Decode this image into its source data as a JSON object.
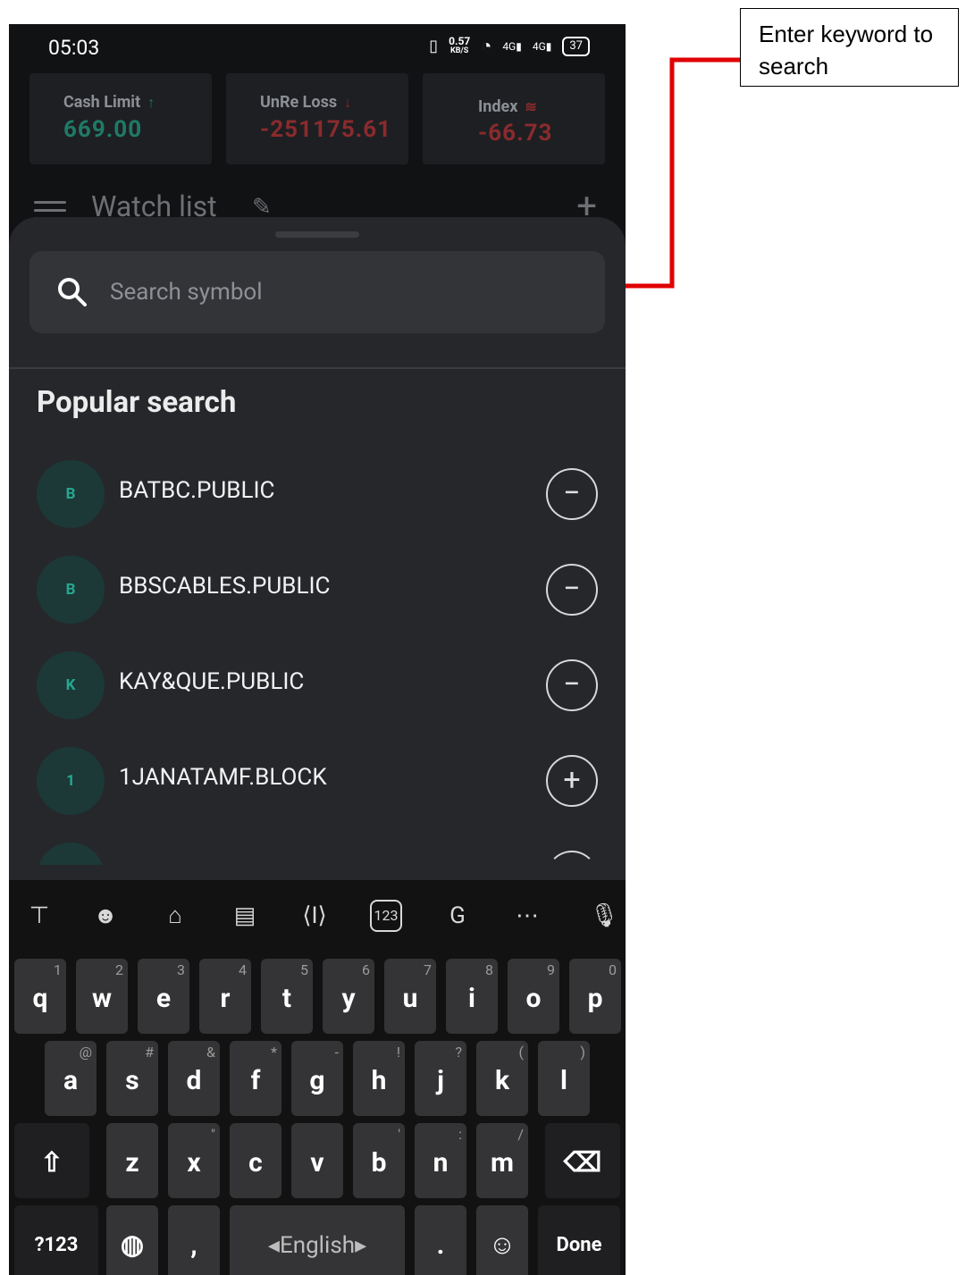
{
  "status_bar": {
    "time": "05:03",
    "speed_value": "0.57",
    "speed_unit": "KB/S",
    "network_1": "4G",
    "network_2": "4G",
    "battery": "37"
  },
  "summary_cards": [
    {
      "label": "Cash Limit",
      "value": "669.00",
      "trend": "up"
    },
    {
      "label": "UnRe Loss",
      "value": "-251175.61",
      "trend": "down"
    },
    {
      "label": "Index",
      "value": "-66.73",
      "trend": "offline"
    }
  ],
  "watch_list": {
    "title": "Watch list"
  },
  "search": {
    "placeholder": "Search symbol"
  },
  "popular": {
    "heading": "Popular search",
    "items": [
      {
        "initial": "B",
        "symbol": "BATBC.PUBLIC",
        "action": "remove"
      },
      {
        "initial": "B",
        "symbol": "BBSCABLES.PUBLIC",
        "action": "remove"
      },
      {
        "initial": "K",
        "symbol": "KAY&QUE.PUBLIC",
        "action": "remove"
      },
      {
        "initial": "1",
        "symbol": "1JANATAMF.BLOCK",
        "action": "add"
      }
    ]
  },
  "keyboard": {
    "row1": [
      "q",
      "w",
      "e",
      "r",
      "t",
      "y",
      "u",
      "i",
      "o",
      "p"
    ],
    "row1_hints": [
      "1",
      "2",
      "3",
      "4",
      "5",
      "6",
      "7",
      "8",
      "9",
      "0"
    ],
    "row2": [
      "a",
      "s",
      "d",
      "f",
      "g",
      "h",
      "j",
      "k",
      "l"
    ],
    "row2_hints": [
      "@",
      "#",
      "&",
      "*",
      "-",
      "!",
      "?",
      "(",
      ")"
    ],
    "row3": [
      "z",
      "x",
      "c",
      "v",
      "b",
      "n",
      "m"
    ],
    "row3_hints": [
      "",
      "\"",
      "",
      "",
      "'",
      ":",
      "/"
    ],
    "symbols_key": "?123",
    "comma_key": ",",
    "space_label": "English",
    "period_key": ".",
    "done_key": "Done",
    "toolbar_numbers_icon": "123"
  },
  "annotation": {
    "callout_text": "Enter keyword to search",
    "arrow_color": "#e00000"
  }
}
